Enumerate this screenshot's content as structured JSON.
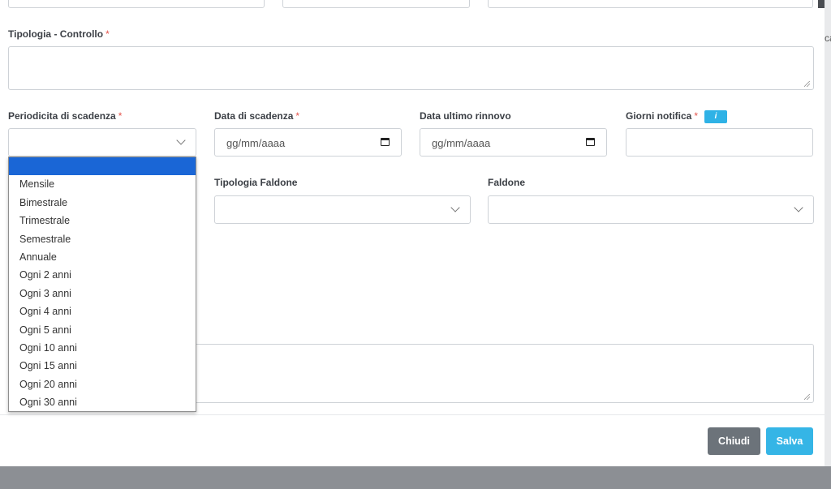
{
  "backdrop": {
    "right_edge_text": "ca"
  },
  "form": {
    "tipologia_controllo_label": "Tipologia - Controllo",
    "required_mark": "*",
    "periodicita_label": "Periodicita di scadenza",
    "data_scadenza_label": "Data di scadenza",
    "data_scadenza_placeholder": "gg/mm/aaaa",
    "data_ultimo_rinnovo_label": "Data ultimo rinnovo",
    "data_ultimo_rinnovo_placeholder": "gg/mm/aaaa",
    "giorni_notifica_label": "Giorni notifica",
    "info_badge": "i",
    "tipologia_faldone_label": "Tipologia Faldone",
    "faldone_label": "Faldone"
  },
  "dropdown": {
    "options": [
      "",
      "Mensile",
      "Bimestrale",
      "Trimestrale",
      "Semestrale",
      "Annuale",
      "Ogni 2 anni",
      "Ogni 3 anni",
      "Ogni 4 anni",
      "Ogni 5 anni",
      "Ogni 10 anni",
      "Ogni 15 anni",
      "Ogni 20 anni",
      "Ogni 30 anni"
    ]
  },
  "footer": {
    "chiudi_label": "Chiudi",
    "salva_label": "Salva"
  },
  "colors": {
    "primary": "#35b5e6",
    "secondary": "#6c737a",
    "required": "#e5534b",
    "selected_option": "#1a66d6"
  }
}
